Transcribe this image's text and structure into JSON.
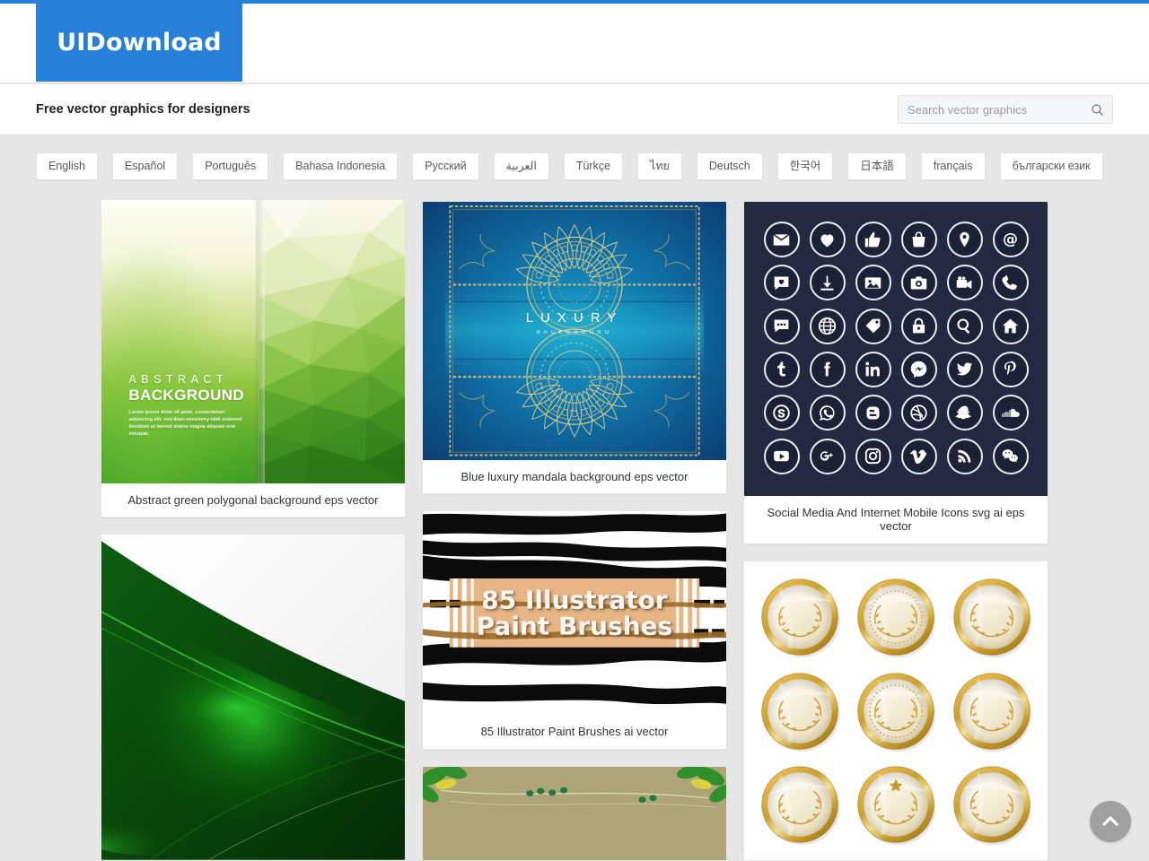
{
  "site": {
    "logo_text": "UIDownload",
    "tagline": "Free vector graphics for designers",
    "brand_color": "#2680d8",
    "background_color": "#eaeaea"
  },
  "search": {
    "placeholder": "Search vector graphics",
    "value": "",
    "icon": "search-icon"
  },
  "languages": [
    {
      "label": "English"
    },
    {
      "label": "Español"
    },
    {
      "label": "Português"
    },
    {
      "label": "Bahasa Indonesia"
    },
    {
      "label": "Русский"
    },
    {
      "label": "العربية"
    },
    {
      "label": "Türkçe"
    },
    {
      "label": "ไทย"
    },
    {
      "label": "Deutsch"
    },
    {
      "label": "한국어"
    },
    {
      "label": "日本語"
    },
    {
      "label": "français"
    },
    {
      "label": "български език"
    }
  ],
  "cards": {
    "polygonal": {
      "caption": "Abstract green polygonal background eps vector",
      "art_title_1": "ABSTRACT",
      "art_title_2": "BACKGROUND",
      "art_body": "Lorem ipsum dolor sit amet, consectetuer adipiscing elit, sed diam nonummy nibh euismod tincidunt ut laoreet dolore magna aliquam erat volutpat."
    },
    "wave": {
      "caption": ""
    },
    "mandala": {
      "caption": "Blue luxury mandala background eps vector",
      "art_title_1": "LUXURY",
      "art_title_2": "BACKGROUND"
    },
    "brushes": {
      "caption": "85 Illustrator Paint Brushes ai vector",
      "art_title_1": "85 Illustrator",
      "art_title_2": "Paint Brushes"
    },
    "leaves": {
      "caption": ""
    },
    "social": {
      "caption": "Social Media And Internet Mobile Icons svg ai eps vector",
      "icons": [
        "envelope-icon",
        "heart-icon",
        "thumbs-up-icon",
        "shopping-bag-icon",
        "location-pin-icon",
        "at-sign-icon",
        "chat-heart-icon",
        "download-icon",
        "photo-icon",
        "camera-icon",
        "video-camera-icon",
        "phone-icon",
        "chat-bubble-icon",
        "globe-icon",
        "tag-icon",
        "lock-icon",
        "search-icon",
        "home-icon",
        "tumblr-icon",
        "facebook-icon",
        "linkedin-icon",
        "messenger-icon",
        "twitter-icon",
        "pinterest-icon",
        "skype-icon",
        "whatsapp-icon",
        "blogger-icon",
        "dribbble-icon",
        "snapchat-icon",
        "soundcloud-icon",
        "youtube-icon",
        "google-plus-icon",
        "instagram-icon",
        "vimeo-icon",
        "rss-icon",
        "wechat-icon"
      ]
    },
    "medals": {
      "caption": "",
      "count": 9
    }
  },
  "scroll_top": {
    "icon": "chevron-up-icon",
    "label": ""
  }
}
